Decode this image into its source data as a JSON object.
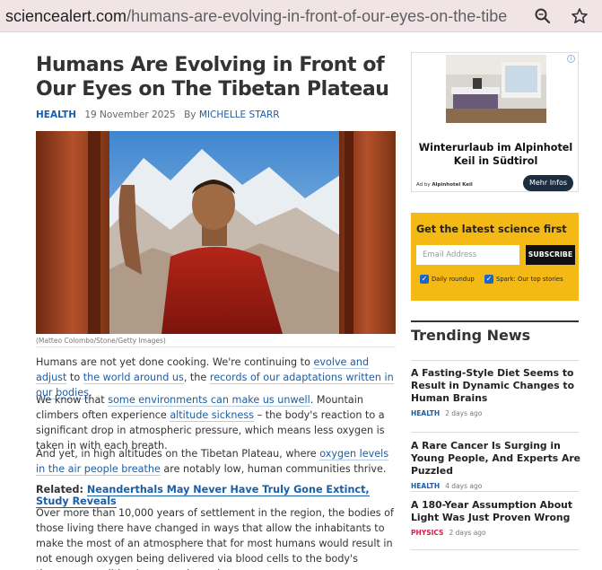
{
  "browser": {
    "url_domain": "sciencealert.com",
    "url_path": "/humans-are-evolving-in-front-of-our-eyes-on-the-tibe…"
  },
  "article": {
    "title": "Humans Are Evolving in Front of Our Eyes on The Tibetan Plateau",
    "category": "HEALTH",
    "date": "19 November 2025",
    "by": "By",
    "author": "MICHELLE STARR",
    "image_caption": "(Matteo Colombo/Stone/Getty Images)",
    "p1": {
      "a": "Humans are not yet done cooking. We're continuing to ",
      "l1": "evolve and adjust",
      "b": " to ",
      "l2": "the world around us",
      "c": ", the ",
      "l3": "records of our adaptations written in our bodies",
      "d": "."
    },
    "p2": {
      "a": "We know that ",
      "l1": "some environments can make us unwell",
      "b": ". Mountain climbers often experience ",
      "l2": "altitude sickness",
      "c": " – the body's reaction to a significant drop in atmospheric pressure, which means less oxygen is taken in with each breath."
    },
    "p3": {
      "a": "And yet, in high altitudes on the Tibetan Plateau, where ",
      "l1": "oxygen levels in the air people breathe",
      "b": " are notably low, human communities thrive."
    },
    "related_label": "Related:",
    "related_link": "Neanderthals May Never Have Truly Gone Extinct, Study Reveals",
    "p4": "Over more than 10,000 years of settlement in the region, the bodies of those living there have changed in ways that allow the inhabitants to make the most of an atmosphere that for most humans would result in not enough oxygen being delivered via blood cells to the body's tissues, a condition known as hypoxia."
  },
  "ad": {
    "title": "Winterurlaub im Alpinhotel Keil in Südtirol",
    "by_label": "Ad by",
    "by_name": "Alpinhotel Keil",
    "button": "Mehr Infos"
  },
  "newsletter": {
    "title": "Get the latest science first",
    "placeholder": "Email Address",
    "subscribe": "SUBSCRIBE",
    "option1": "Daily roundup",
    "option2": "Spark: Our top stories"
  },
  "trending": {
    "heading": "Trending News",
    "items": [
      {
        "title": "A Fasting-Style Diet Seems to Result in Dynamic Changes to Human Brains",
        "category": "HEALTH",
        "category_color": "#1b5ea8",
        "time": "2 days ago"
      },
      {
        "title": "A Rare Cancer Is Surging in Young People, And Experts Are Puzzled",
        "category": "HEALTH",
        "category_color": "#1b5ea8",
        "time": "4 days ago"
      },
      {
        "title": "A 180-Year Assumption About Light Was Just Proven Wrong",
        "category": "PHYSICS",
        "category_color": "#d0214b",
        "time": "2 days ago"
      }
    ]
  }
}
